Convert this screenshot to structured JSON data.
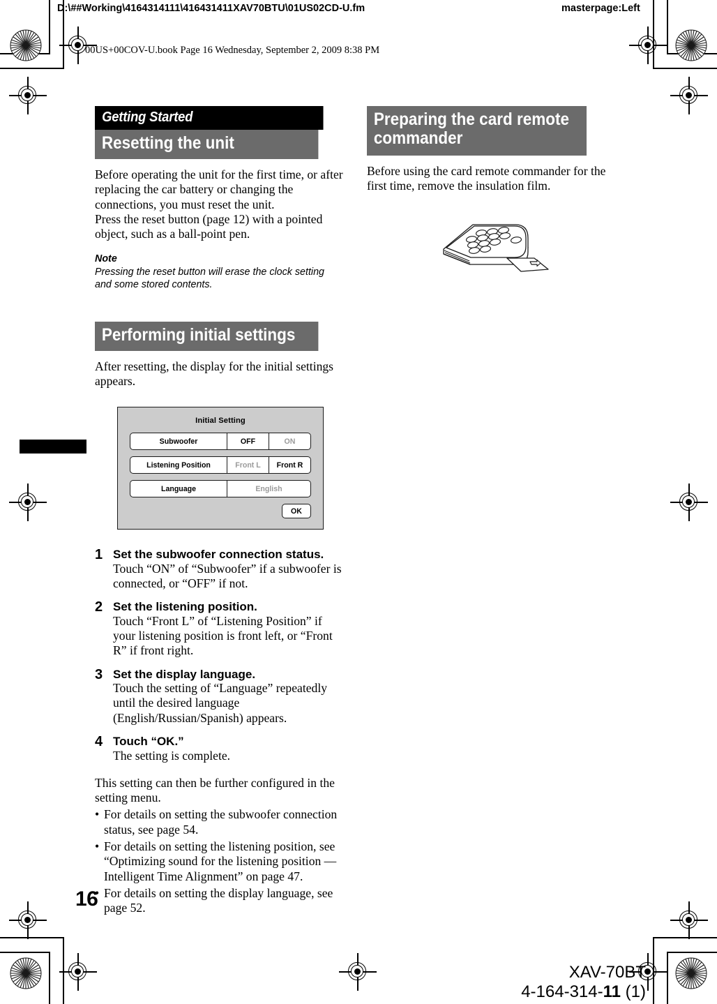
{
  "prepress": {
    "file_path": "D:\\##Working\\4164314111\\416431411XAV70BTU\\01US02CD-U.fm",
    "masterpage": "masterpage:Left",
    "book_line": "00US+00COV-U.book  Page 16  Wednesday, September 2, 2009  8:38 PM"
  },
  "left_column": {
    "chapter_banner": "Getting Started",
    "section1_title": "Resetting the unit",
    "section1_paragraph": "Before operating the unit for the first time, or after replacing the car battery or changing the connections, you must reset the unit.\nPress the reset button (page 12) with a pointed object, such as a ball-point pen.",
    "note_heading": "Note",
    "note_text": "Pressing the reset button will erase the clock setting and some stored contents.",
    "section2_title": "Performing initial settings",
    "section2_paragraph": "After resetting, the display for the initial settings appears.",
    "lcd": {
      "title": "Initial Setting",
      "rows": [
        {
          "label": "Subwoofer",
          "options": [
            {
              "text": "OFF",
              "state": "active"
            },
            {
              "text": "ON",
              "state": "dim"
            }
          ]
        },
        {
          "label": "Listening Position",
          "options": [
            {
              "text": "Front L",
              "state": "dim"
            },
            {
              "text": "Front R",
              "state": "active"
            }
          ]
        },
        {
          "label": "Language",
          "options": [
            {
              "text": "English",
              "state": "dim"
            }
          ]
        }
      ],
      "ok_label": "OK"
    },
    "steps": [
      {
        "num": "1",
        "title": "Set the subwoofer connection status.",
        "body": "Touch “ON” of “Subwoofer” if a subwoofer is connected, or “OFF” if not."
      },
      {
        "num": "2",
        "title": "Set the listening position.",
        "body": "Touch “Front L” of “Listening Position” if your listening position is front left, or “Front R” if front right."
      },
      {
        "num": "3",
        "title": "Set the display language.",
        "body": "Touch the setting of “Language” repeatedly until the desired language (English/Russian/Spanish) appears."
      },
      {
        "num": "4",
        "title": "Touch “OK.”",
        "body": "The setting is complete."
      }
    ],
    "closing_paragraph": "This setting can then be further configured in the setting menu.",
    "bullet_marker": "•",
    "bullets": [
      "For details on setting the subwoofer connection status, see page 54.",
      "For details on setting the listening position, see “Optimizing sound for the listening position — Intelligent Time Alignment” on page 47.",
      "For details on setting the display language, see page 52."
    ]
  },
  "right_column": {
    "section_title": "Preparing the card remote commander",
    "paragraph": "Before using the card remote commander for the first time, remove the insulation film.",
    "figure_name": "card-remote-commander-insulation-film"
  },
  "footer": {
    "page_number": "16",
    "model": "XAV-70BT",
    "part_number_prefix": "4-164-314-",
    "part_number_bold": "11",
    "part_number_suffix": " (1)"
  },
  "colors": {
    "chapter_banner_bg": "#000000",
    "section_banner_bg": "#6b6b6b",
    "lcd_bg": "#cccccc",
    "lcd_row_bg": "#ffffff",
    "dim_text": "#9a9a9a"
  }
}
